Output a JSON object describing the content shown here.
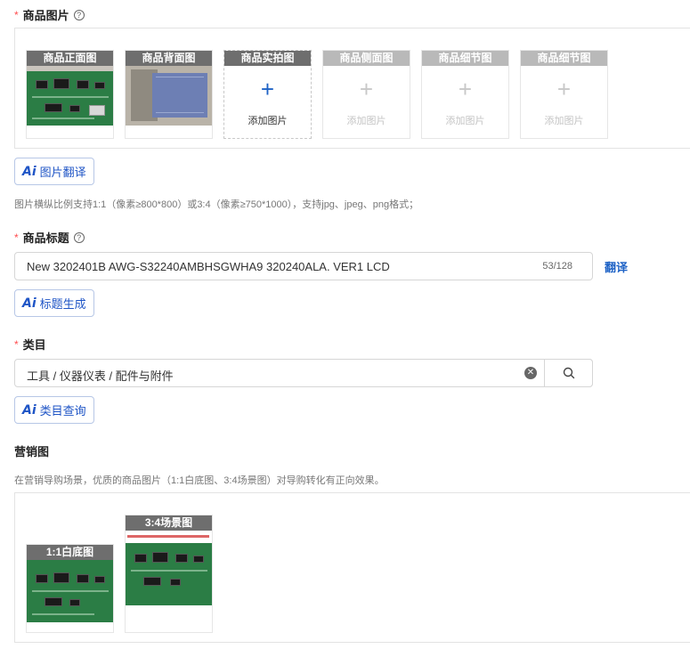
{
  "product_images": {
    "label": "商品图片",
    "required_mark": "*",
    "help_icon": "question-circle-icon",
    "slots": [
      {
        "title": "商品正面图",
        "state": "filled"
      },
      {
        "title": "商品背面图",
        "state": "filled"
      },
      {
        "title": "商品实拍图",
        "state": "empty",
        "add_text": "添加图片"
      },
      {
        "title": "商品侧面图",
        "state": "disabled",
        "add_text": "添加图片"
      },
      {
        "title": "商品细节图",
        "state": "disabled",
        "add_text": "添加图片"
      },
      {
        "title": "商品细节图",
        "state": "disabled",
        "add_text": "添加图片"
      }
    ],
    "plus_glyph": "+",
    "ai_button": {
      "icon": "ai-icon",
      "glyph": "Ai",
      "label": "图片翻译"
    },
    "hint": "图片横纵比例支持1:1（像素≥800*800）或3:4（像素≥750*1000），支持jpg、jpeg、png格式；"
  },
  "product_title": {
    "label": "商品标题",
    "required_mark": "*",
    "help_icon": "question-circle-icon",
    "value": "New 3202401B AWG-S32240AMBHSGWHA9 320240ALA. VER1 LCD",
    "counter": "53/128",
    "translate_link": "翻译",
    "ai_button": {
      "icon": "ai-icon",
      "glyph": "Ai",
      "label": "标题生成"
    }
  },
  "category": {
    "label": "类目",
    "required_mark": "*",
    "value": "工具 / 仪器仪表 / 配件与附件",
    "clear_icon": "clear-circle-icon",
    "clear_glyph": "✕",
    "search_icon": "search-icon",
    "ai_button": {
      "icon": "ai-icon",
      "glyph": "Ai",
      "label": "类目查询"
    }
  },
  "marketing": {
    "label": "营销图",
    "hint": "在营销导购场景，优质的商品图片（1:1白底图、3:4场景图）对导购转化有正向效果。",
    "slots": [
      {
        "title": "1:1白底图",
        "state": "filled"
      },
      {
        "title": "3:4场景图",
        "state": "filled"
      }
    ]
  },
  "colors": {
    "accent": "#1f63c6",
    "required": "#ff4d4f",
    "slot_title_bg": "#6e6e6e",
    "slot_title_disabled_bg": "#b9b9b9",
    "pcb_green": "#2b7d45"
  }
}
